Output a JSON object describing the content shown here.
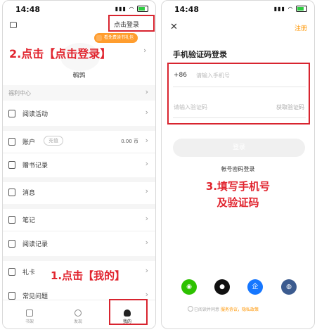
{
  "left_phone": {
    "time": "14:48",
    "login_link": "点击登录",
    "promo_badge": "看免费读书礼包",
    "nickname": "鹌鹑",
    "welfare_center": "福利中心",
    "menu": [
      {
        "label": "阅读活动",
        "icon": "book-icon"
      },
      {
        "label": "账户",
        "icon": "wallet-icon",
        "recharge": "充值",
        "balance": "0.00 币"
      },
      {
        "label": "赠书记录",
        "icon": "gift-record-icon"
      },
      {
        "label": "消息",
        "icon": "message-icon"
      },
      {
        "label": "笔记",
        "icon": "note-icon"
      },
      {
        "label": "阅读记录",
        "icon": "history-icon"
      },
      {
        "label": "礼卡",
        "icon": "card-icon"
      },
      {
        "label": "常见问题",
        "icon": "help-icon"
      }
    ],
    "tabs": [
      {
        "label": "书架",
        "icon": "bookshelf-icon"
      },
      {
        "label": "发现",
        "icon": "discover-icon"
      },
      {
        "label": "我的",
        "icon": "profile-icon"
      }
    ],
    "annotation_step2": "2.点击【点击登录】",
    "annotation_step1": "1.点击【我的】"
  },
  "right_phone": {
    "time": "14:48",
    "register_link": "注册",
    "title": "手机验证码登录",
    "country_code": "+86",
    "phone_placeholder": "请输入手机号",
    "code_placeholder": "请输入验证码",
    "get_code": "获取验证码",
    "login_button": "登录",
    "password_login": "帐号密码登录",
    "annotation_step3_line1": "3.填写手机号",
    "annotation_step3_line2": "及验证码",
    "agreement": "已阅读并同意",
    "agreement_link": "服务协议，隐私政策",
    "social": [
      {
        "name": "wechat-icon",
        "color": "#2dc100",
        "glyph": "◉"
      },
      {
        "name": "apple-icon",
        "color": "#111111",
        "glyph": ""
      },
      {
        "name": "enterprise-icon",
        "color": "#1677ff",
        "glyph": "企"
      },
      {
        "name": "globe-icon",
        "color": "#3b5b8f",
        "glyph": "◍"
      }
    ],
    "colors": {
      "accent": "#ff9500",
      "annotation": "#e1252f"
    }
  }
}
